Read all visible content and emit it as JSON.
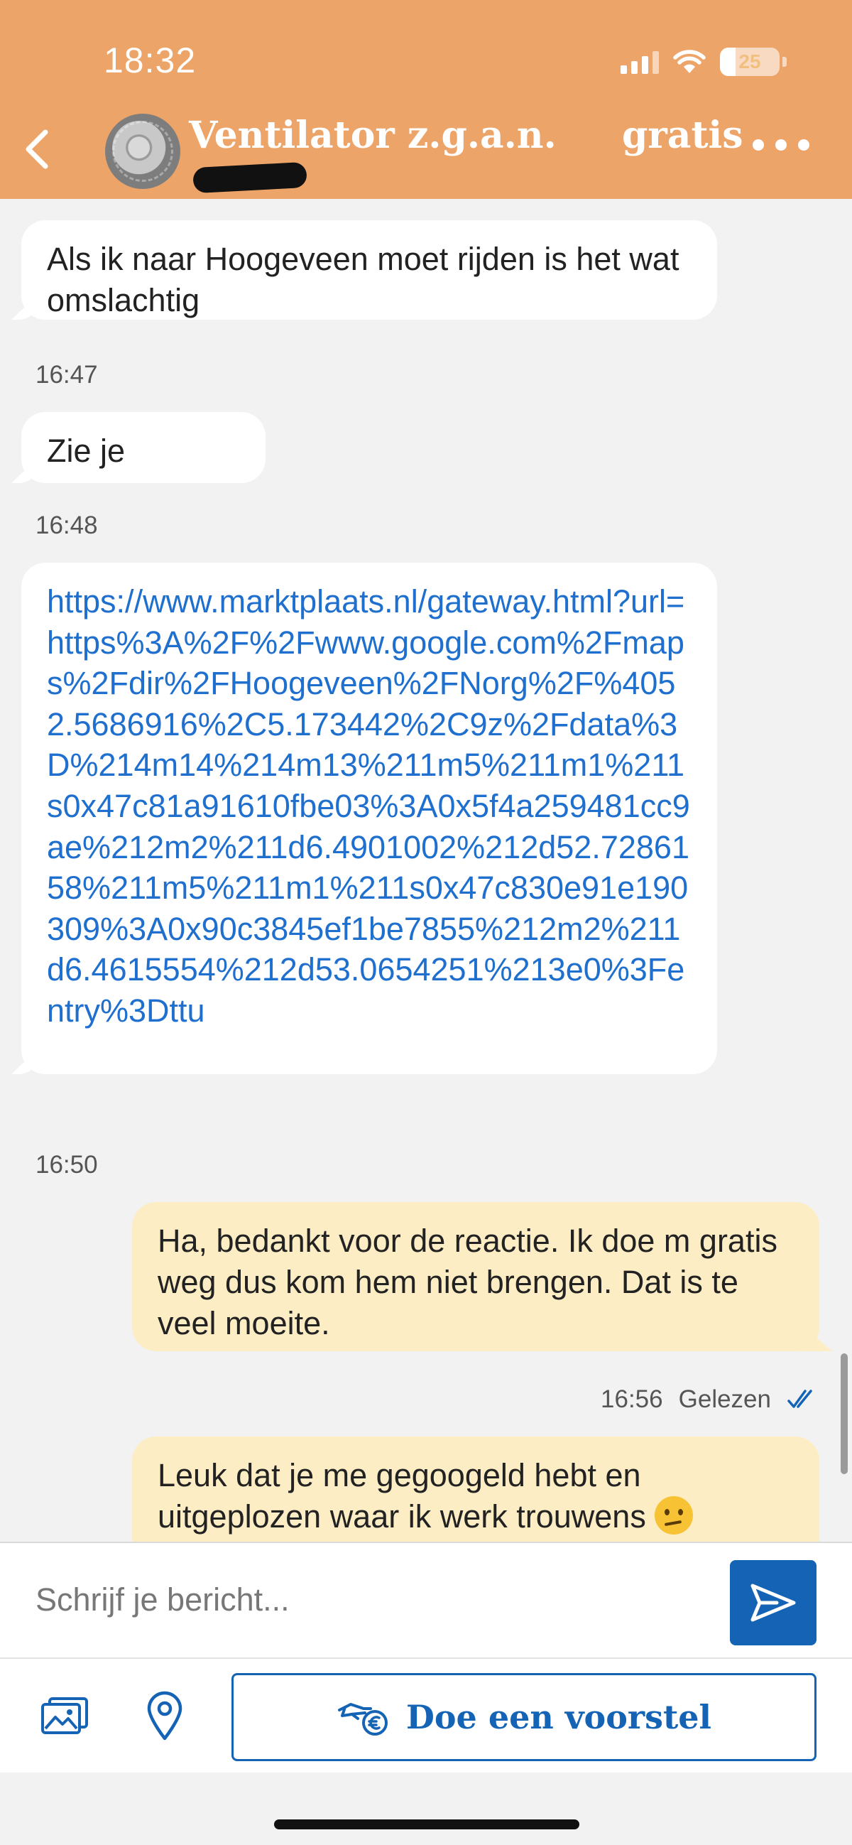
{
  "status_bar": {
    "time": "18:32",
    "battery": "25"
  },
  "header": {
    "title": "Ventilator z.g.a.n.",
    "price": "gratis"
  },
  "messages": [
    {
      "type": "incoming",
      "text": "Als ik naar Hoogeveen moet rijden is het wat omslachtig"
    },
    {
      "type": "timestamp",
      "text": "16:47"
    },
    {
      "type": "incoming",
      "text": "Zie je"
    },
    {
      "type": "timestamp",
      "text": "16:48"
    },
    {
      "type": "incoming_link",
      "text": "https://www.marktplaats.nl/gateway.html?url=https%3A%2F%2Fwww.google.com%2Fmaps%2Fdir%2FHoogeveen%2FNorg%2F%4052.5686916%2C5.173442%2C9z%2Fdata%3D%214m14%214m13%211m5%211m1%211s0x47c81a91610fbe03%3A0x5f4a259481cc9ae%212m2%211d6.4901002%212d52.7286158%211m5%211m1%211s0x47c830e91e190309%3A0x90c3845ef1be7855%212m2%211d6.4615554%212d53.0654251%213e0%3Fentry%3Dttu"
    },
    {
      "type": "timestamp",
      "text": "16:50"
    },
    {
      "type": "outgoing",
      "text": "Ha, bedankt voor de reactie. Ik doe m gratis weg dus kom hem niet brengen. Dat is te veel moeite."
    },
    {
      "type": "read_receipt",
      "time": "16:56",
      "status": "Gelezen"
    },
    {
      "type": "outgoing",
      "text": "Leuk dat je me gegoogeld hebt en uitgeplozen waar ik werk trouwens",
      "emoji": "confused-face"
    }
  ],
  "composer": {
    "placeholder": "Schrijf je bericht..."
  },
  "actions": {
    "offer_label": "Doe een voorstel"
  },
  "colors": {
    "header": "#eda468",
    "brand_blue": "#1463b5",
    "link": "#1f6fce",
    "incoming_bubble": "#ffffff",
    "outgoing_bubble": "#fdedc5"
  }
}
